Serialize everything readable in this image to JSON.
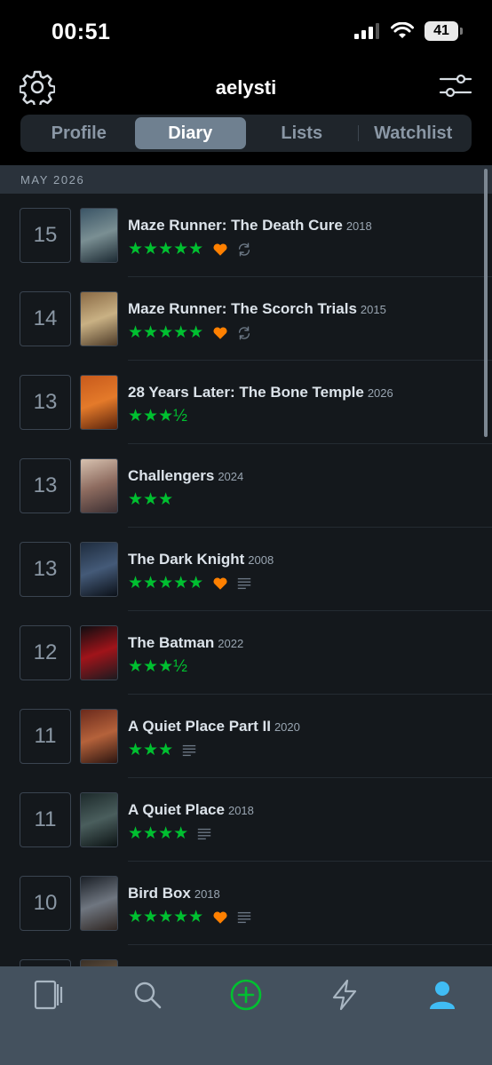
{
  "status": {
    "time": "00:51",
    "battery": "41"
  },
  "header": {
    "username": "aelysti"
  },
  "tabs": [
    {
      "label": "Profile",
      "active": false
    },
    {
      "label": "Diary",
      "active": true
    },
    {
      "label": "Lists",
      "active": false
    },
    {
      "label": "Watchlist",
      "active": false
    }
  ],
  "month": "MAY 2026",
  "colors": {
    "stars": "#00c030",
    "heart": "#ff8000",
    "add": "#00c030",
    "profile": "#40bcf4"
  },
  "entries": [
    {
      "day": "15",
      "title": "Maze Runner: The Death Cure",
      "year": "2018",
      "stars": "★★★★★",
      "liked": true,
      "rewatch": true,
      "review": false,
      "poster": "maze-runner-death-cure"
    },
    {
      "day": "14",
      "title": "Maze Runner: The Scorch Trials",
      "year": "2015",
      "stars": "★★★★★",
      "liked": true,
      "rewatch": true,
      "review": false,
      "poster": "maze-runner-scorch-trials"
    },
    {
      "day": "13",
      "title": "28 Years Later: The Bone Temple",
      "year": "2026",
      "stars": "★★★½",
      "liked": false,
      "rewatch": false,
      "review": false,
      "poster": "28-years-later"
    },
    {
      "day": "13",
      "title": "Challengers",
      "year": "2024",
      "stars": "★★★",
      "liked": false,
      "rewatch": false,
      "review": false,
      "poster": "challengers"
    },
    {
      "day": "13",
      "title": "The Dark Knight",
      "year": "2008",
      "stars": "★★★★★",
      "liked": true,
      "rewatch": false,
      "review": true,
      "poster": "dark-knight"
    },
    {
      "day": "12",
      "title": "The Batman",
      "year": "2022",
      "stars": "★★★½",
      "liked": false,
      "rewatch": false,
      "review": false,
      "poster": "the-batman"
    },
    {
      "day": "11",
      "title": "A Quiet Place Part II",
      "year": "2020",
      "stars": "★★★",
      "liked": false,
      "rewatch": false,
      "review": true,
      "poster": "quiet-place-2"
    },
    {
      "day": "11",
      "title": "A Quiet Place",
      "year": "2018",
      "stars": "★★★★",
      "liked": false,
      "rewatch": false,
      "review": true,
      "poster": "quiet-place"
    },
    {
      "day": "10",
      "title": "Bird Box",
      "year": "2018",
      "stars": "★★★★★",
      "liked": true,
      "rewatch": false,
      "review": true,
      "poster": "bird-box"
    },
    {
      "day": "",
      "title": "",
      "year": "",
      "stars": "",
      "liked": false,
      "rewatch": false,
      "review": false,
      "poster": "partial"
    }
  ],
  "tabbar": [
    "films-icon",
    "search-icon",
    "add-icon",
    "activity-icon",
    "profile-icon"
  ]
}
